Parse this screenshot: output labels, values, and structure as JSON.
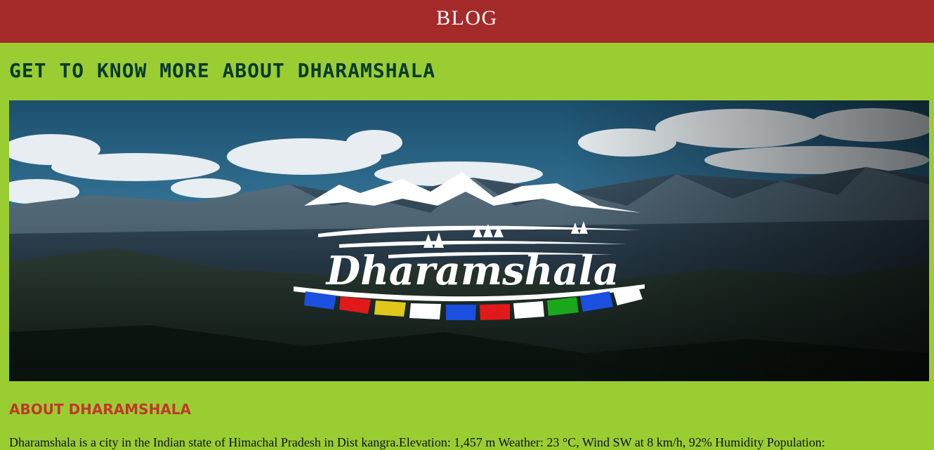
{
  "header": {
    "title": "BLOG"
  },
  "page": {
    "heading": "GET TO KNOW MORE ABOUT DHARAMSHALA"
  },
  "hero": {
    "logo_text": "Dharamshala"
  },
  "about": {
    "title": "ABOUT DHARAMSHALA",
    "text": "Dharamshala is a city in the Indian state of Himachal Pradesh in Dist kangra.Elevation: 1,457 m Weather: 23 °C, Wind SW at 8 km/h, 92% Humidity Population:"
  },
  "colors": {
    "header_bg": "#a52a2a",
    "page_bg": "#9acd32",
    "heading": "#0a3a2e",
    "section_title": "#c0392b"
  }
}
